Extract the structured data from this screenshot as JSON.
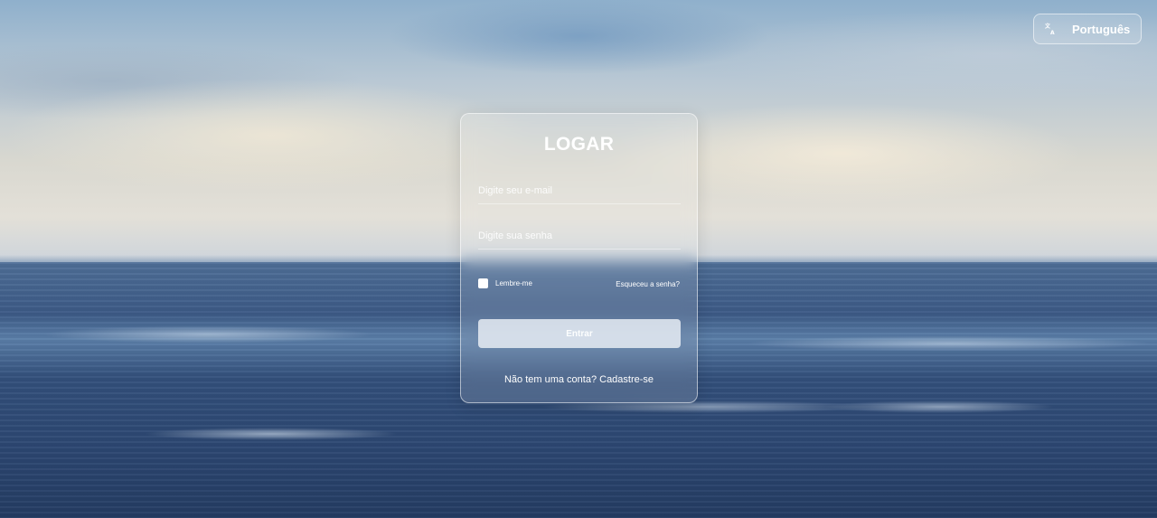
{
  "language_selector": {
    "label": "Português",
    "icon": "translate-icon"
  },
  "login": {
    "title": "LOGAR",
    "email_placeholder": "Digite seu e-mail",
    "email_value": "",
    "password_placeholder": "Digite sua senha",
    "password_value": "",
    "remember_label": "Lembre-me",
    "remember_checked": false,
    "forgot_label": "Esqueceu a senha?",
    "submit_label": "Entrar",
    "signup_text": "Não tem uma conta? Cadastre-se"
  },
  "colors": {
    "card_border": "#ffffff",
    "text": "#ffffff",
    "sea": "#2d4873",
    "sky": "#b9c8d4"
  }
}
